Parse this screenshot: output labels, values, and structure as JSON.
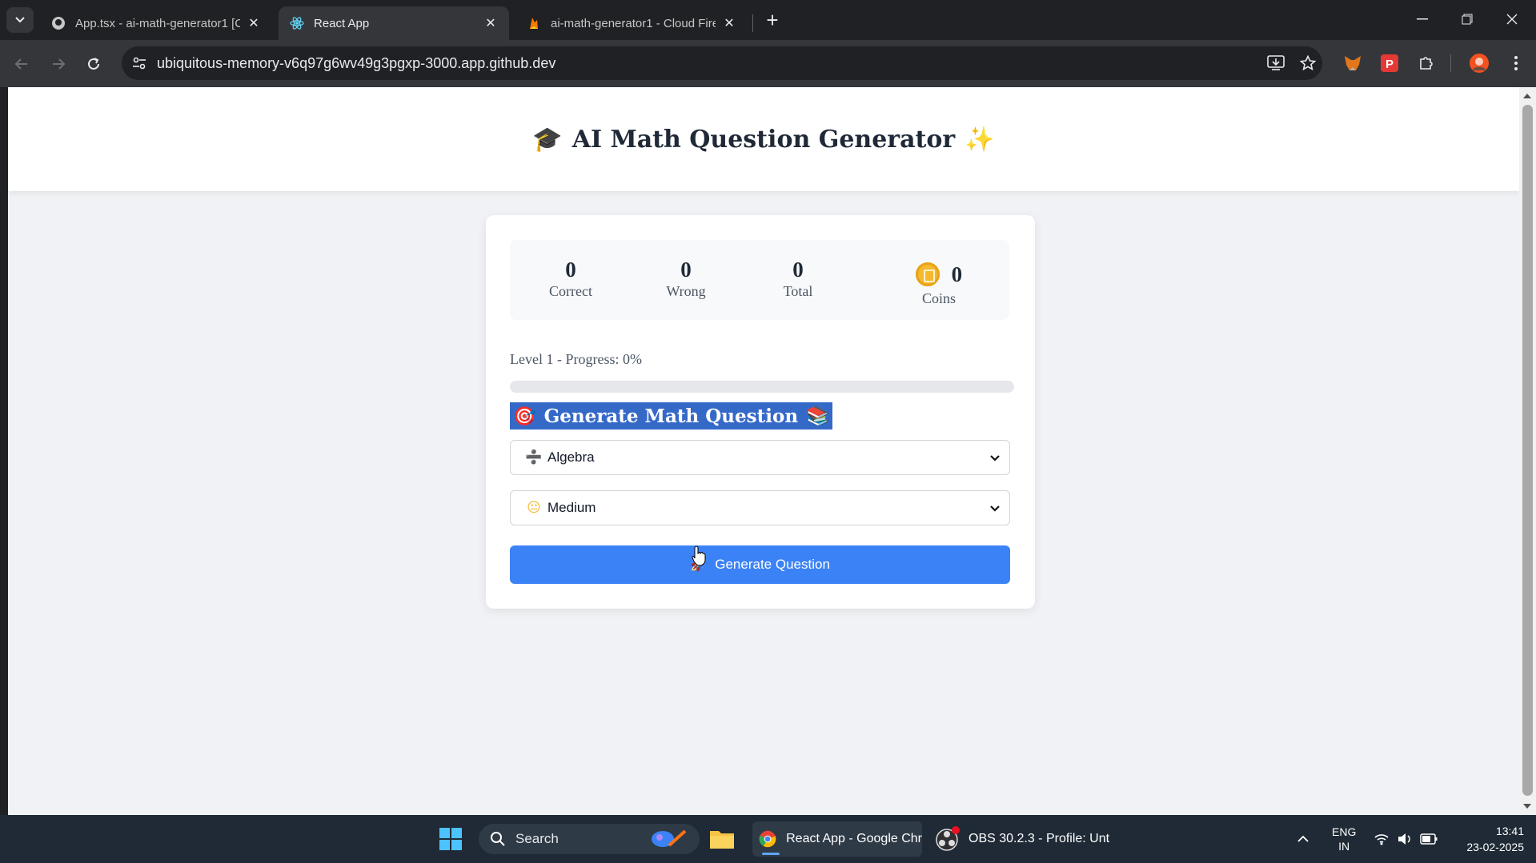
{
  "browser": {
    "tabs": [
      {
        "title": "App.tsx - ai-math-generator1 [C",
        "active": false,
        "icon": "github-icon"
      },
      {
        "title": "React App",
        "active": true,
        "icon": "react-icon"
      },
      {
        "title": "ai-math-generator1 - Cloud Fire",
        "active": false,
        "icon": "firebase-icon"
      }
    ],
    "url": "ubiquitous-memory-v6q97g6wv49g3pgxp-3000.app.github.dev"
  },
  "app": {
    "title_icon": "🎓",
    "title": "AI Math Question Generator",
    "title_trail": "✨"
  },
  "stats": {
    "correct_value": "0",
    "correct_label": "Correct",
    "wrong_value": "0",
    "wrong_label": "Wrong",
    "total_value": "0",
    "total_label": "Total",
    "coins_value": "0",
    "coins_label": "Coins"
  },
  "progress": {
    "label": "Level 1 - Progress: 0%",
    "percent": 0
  },
  "generator": {
    "heading_icon": "🎯",
    "heading": "Generate Math Question",
    "heading_trail": "📚",
    "topic_icon": "➗",
    "topic_selected": "Algebra",
    "difficulty_icon": "😐",
    "difficulty_selected": "Medium",
    "button_icon": "🚀",
    "button_label": "Generate Question"
  },
  "taskbar": {
    "search_label": "Search",
    "chrome_label": "React App - Google Chr",
    "obs_label": "OBS 30.2.3 - Profile: Unt",
    "lang_top": "ENG",
    "lang_bottom": "IN",
    "time": "13:41",
    "date": "23-02-2025"
  },
  "colors": {
    "accent": "#3b82f6",
    "heading_bg": "#3569c8",
    "page_bg": "#f0f2f5"
  }
}
